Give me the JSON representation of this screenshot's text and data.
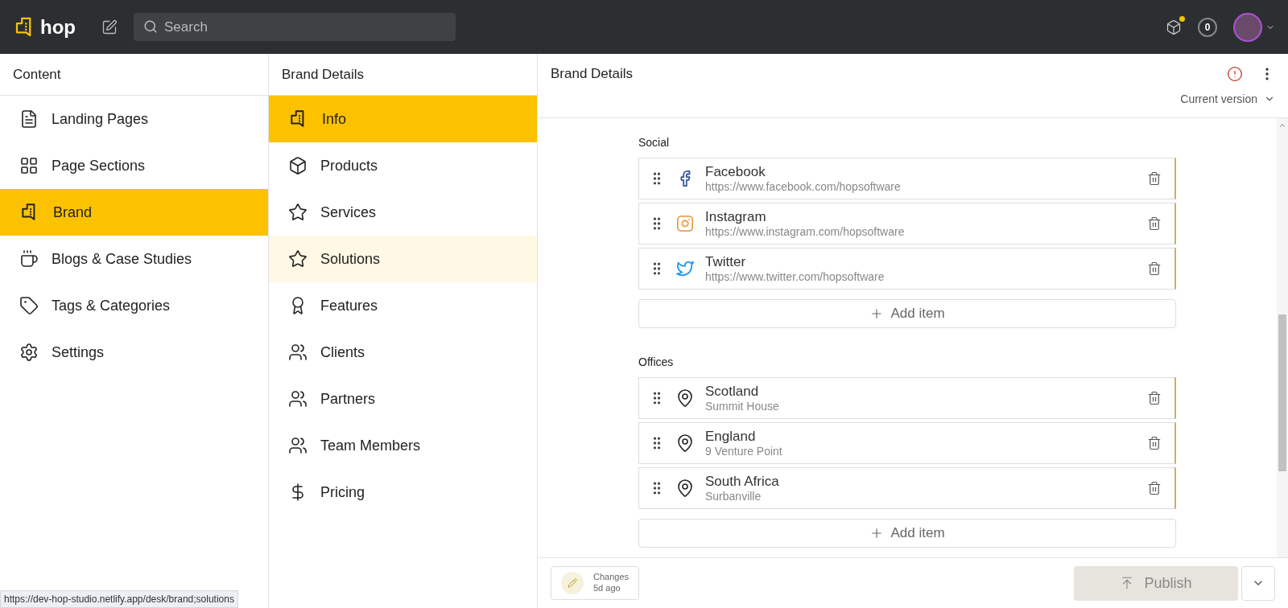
{
  "topbar": {
    "logo": "hop",
    "search": {
      "placeholder": "Search"
    },
    "notifications": {
      "badge": true
    },
    "counter": "0"
  },
  "content_nav": {
    "title": "Content",
    "items": [
      {
        "label": "Landing Pages",
        "selected": false
      },
      {
        "label": "Page Sections",
        "selected": false
      },
      {
        "label": "Brand",
        "selected": true
      },
      {
        "label": "Blogs & Case Studies",
        "selected": false
      },
      {
        "label": "Tags & Categories",
        "selected": false
      },
      {
        "label": "Settings",
        "selected": false
      }
    ]
  },
  "brand_nav": {
    "title": "Brand Details",
    "items": [
      {
        "label": "Info",
        "selected": true,
        "hovered": false
      },
      {
        "label": "Products",
        "selected": false,
        "hovered": false
      },
      {
        "label": "Services",
        "selected": false,
        "hovered": false
      },
      {
        "label": "Solutions",
        "selected": false,
        "hovered": true
      },
      {
        "label": "Features",
        "selected": false,
        "hovered": false
      },
      {
        "label": "Clients",
        "selected": false,
        "hovered": false
      },
      {
        "label": "Partners",
        "selected": false,
        "hovered": false
      },
      {
        "label": "Team Members",
        "selected": false,
        "hovered": false
      },
      {
        "label": "Pricing",
        "selected": false,
        "hovered": false
      }
    ]
  },
  "editor": {
    "title": "Brand Details",
    "version": "Current version",
    "has_error": true,
    "sections": [
      {
        "label": "Social",
        "add_label": "Add item",
        "items": [
          {
            "kind": "facebook",
            "title": "Facebook",
            "subtitle": "https://www.facebook.com/hopsoftware",
            "color": "#3b5998"
          },
          {
            "kind": "instagram",
            "title": "Instagram",
            "subtitle": "https://www.instagram.com/hopsoftware",
            "color": "#e8a04c"
          },
          {
            "kind": "twitter",
            "title": "Twitter",
            "subtitle": "https://www.twitter.com/hopsoftware",
            "color": "#1d9bf0"
          }
        ]
      },
      {
        "label": "Offices",
        "add_label": "Add item",
        "items": [
          {
            "kind": "location",
            "title": "Scotland",
            "subtitle": "Summit House",
            "color": "#222222"
          },
          {
            "kind": "location",
            "title": "England",
            "subtitle": "9 Venture Point",
            "color": "#222222"
          },
          {
            "kind": "location",
            "title": "South Africa",
            "subtitle": "Surbanville",
            "color": "#222222"
          }
        ]
      }
    ]
  },
  "footer": {
    "changes": "Changes",
    "changes_time": "5d ago",
    "publish": "Publish",
    "publish_disabled": true
  },
  "status_url": "https://dev-hop-studio.netlify.app/desk/brand;solutions"
}
